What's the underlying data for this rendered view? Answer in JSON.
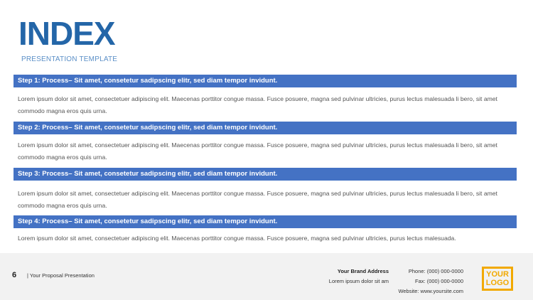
{
  "header": {
    "title": "INDEX",
    "subtitle": "PRESENTATION TEMPLATE"
  },
  "steps": [
    {
      "heading": "Step 1: Process– Sit amet, consetetur sadipscing elitr, sed diam tempor invidunt.",
      "body": "Lorem ipsum dolor sit amet, consectetuer adipiscing elit. Maecenas porttitor congue massa. Fusce posuere, magna sed pulvinar ultricies, purus lectus malesuada li bero, sit amet commodo magna eros quis urna."
    },
    {
      "heading": "Step 2: Process– Sit amet, consetetur sadipscing elitr, sed diam tempor invidunt.",
      "body": "Lorem ipsum dolor sit amet, consectetuer adipiscing elit. Maecenas porttitor congue massa. Fusce posuere, magna sed pulvinar ultricies, purus lectus malesuada li bero, sit amet commodo magna eros quis urna."
    },
    {
      "heading": "Step 3: Process– Sit amet, consetetur sadipscing elitr, sed diam tempor invidunt.",
      "body": "Lorem ipsum dolor sit amet, consectetuer adipiscing elit. Maecenas porttitor congue massa. Fusce posuere, magna sed pulvinar ultricies, purus lectus malesuada li bero, sit amet commodo magna eros quis urna."
    },
    {
      "heading": "Step 4: Process– Sit amet, consetetur sadipscing elitr, sed diam tempor invidunt.",
      "body": "Lorem ipsum dolor sit amet, consectetuer adipiscing elit. Maecenas porttitor congue massa. Fusce posuere, magna sed pulvinar ultricies, purus lectus malesuada."
    }
  ],
  "footer": {
    "page_number": "6",
    "label": "| Your Proposal Presentation",
    "brand_name": "Your Brand Address",
    "brand_address": "Lorem ipsum dolor sit am",
    "phone": "Phone: (000) 000-0000",
    "fax": "Fax: (000) 000-0000",
    "website": "Website: www.yoursite.com",
    "logo_line1": "YOUR",
    "logo_line2": "LOGO"
  },
  "colors": {
    "title": "#2466a8",
    "step_bar": "#4472c4",
    "logo": "#f2a900",
    "footer_bg": "#f2f2f2"
  }
}
